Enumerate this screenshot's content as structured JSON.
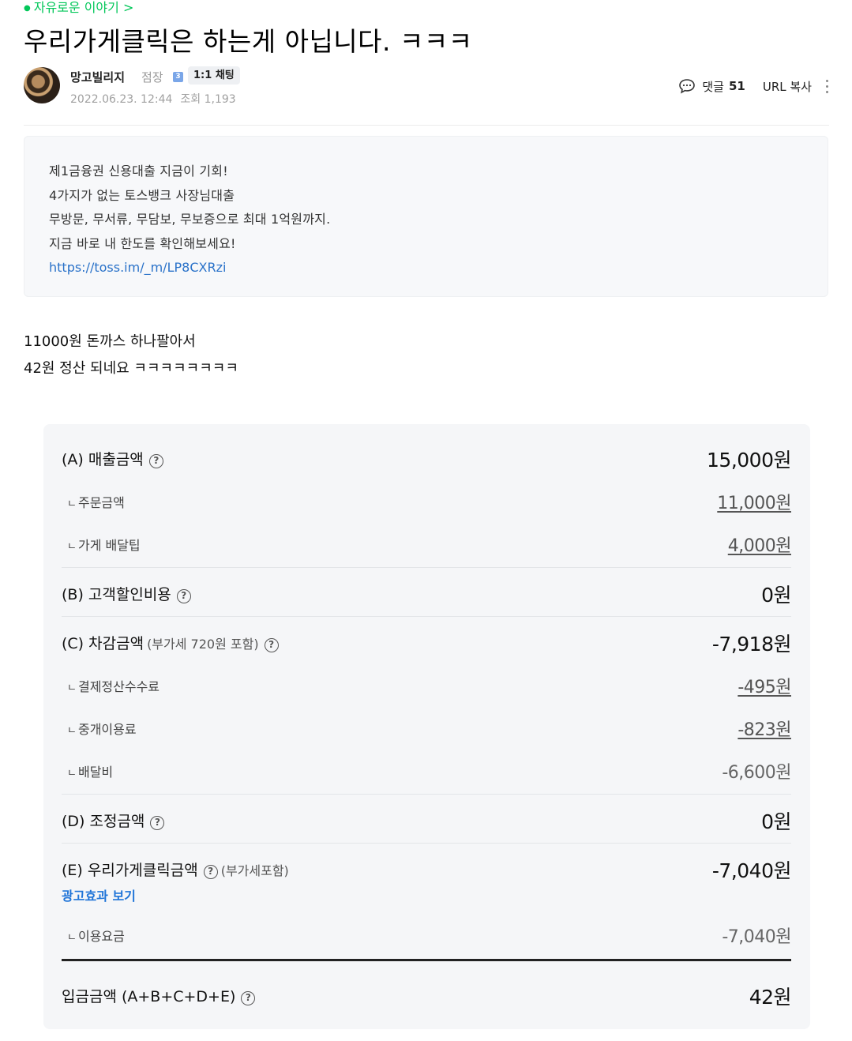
{
  "breadcrumb": {
    "label": "자유로운 이야기 >"
  },
  "post": {
    "title": "우리가게클릭은 하는게 아닙니다. ㅋㅋㅋ",
    "author": {
      "name": "망고빌리지",
      "role": "점장",
      "role_badge": "3",
      "chat_label": "1:1 채팅",
      "date": "2022.06.23. 12:44",
      "views": "조회 1,193"
    },
    "actions": {
      "comment_label": "댓글",
      "comment_count": "51",
      "url_copy": "URL 복사"
    },
    "ad": {
      "lines": [
        "제1금융권 신용대출 지금이 기회!",
        "4가지가 없는 토스뱅크 사장님대출",
        "무방문, 무서류, 무담보, 무보증으로 최대 1억원까지.",
        "지금 바로 내 한도를 확인해보세요!"
      ],
      "link": "https://toss.im/_m/LP8CXRzi"
    },
    "body": [
      "11000원 돈까스 하나팔아서",
      "42원 정산 되네요 ㅋㅋㅋㅋㅋㅋㅋㅋ"
    ]
  },
  "settlement": {
    "corner_glyph": "ㄴ",
    "help_glyph": "?",
    "sales": {
      "label": "(A) 매출금액",
      "value": "15,000원"
    },
    "order": {
      "label": "주문금액",
      "value": "11,000원"
    },
    "tip": {
      "label": "가게 배달팁",
      "value": "4,000원"
    },
    "discount": {
      "label": "(B) 고객할인비용",
      "value": "0원"
    },
    "deduct": {
      "label": "(C) 차감금액",
      "hint": "(부가세 720원 포함)",
      "value": "-7,918원"
    },
    "fee": {
      "label": "결제정산수수료",
      "value": "-495원"
    },
    "brokerage": {
      "label": "중개이용료",
      "value": "-823원"
    },
    "delivery": {
      "label": "배달비",
      "value": "-6,600원"
    },
    "adjust": {
      "label": "(D) 조정금액",
      "value": "0원"
    },
    "click": {
      "label": "(E) 우리가게클릭금액",
      "hint": "(부가세포함)",
      "value": "-7,040원",
      "link": "광고효과 보기"
    },
    "usage": {
      "label": "이용요금",
      "value": "-7,040원"
    },
    "deposit": {
      "label": "입금금액 (A+B+C+D+E)",
      "value": "42원"
    }
  }
}
